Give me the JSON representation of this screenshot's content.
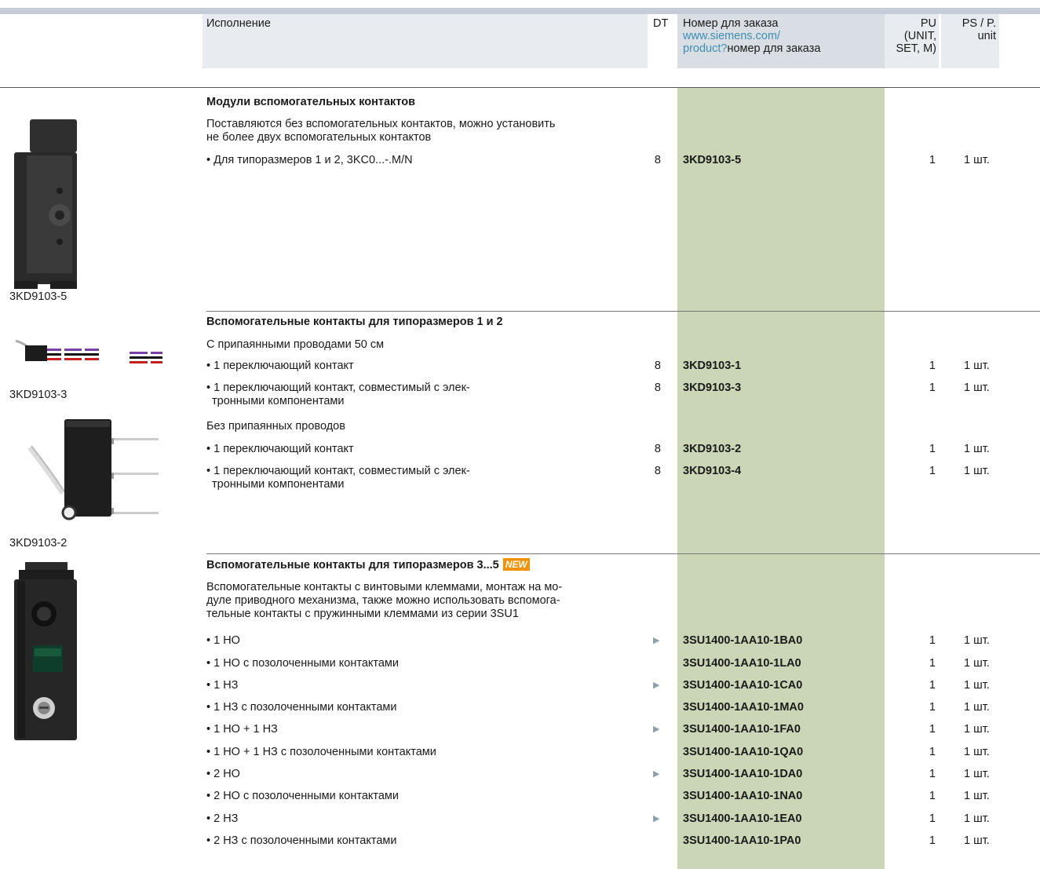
{
  "header": {
    "execution": "Исполнение",
    "dt": "DT",
    "order_line1": "Номер для заказа",
    "order_link1": "www.siemens.com/",
    "order_link2": "product?",
    "order_rest": "номер для заказа",
    "pu_line1": "PU",
    "pu_line2": "(UNIT,",
    "pu_line3": "SET, M)",
    "ps_line1": "PS / P.",
    "ps_line2": "unit"
  },
  "captions": {
    "img1": "3KD9103-5",
    "img2": "3KD9103-3",
    "img3": "3KD9103-2"
  },
  "section1": {
    "title": "Модули вспомогательных контактов",
    "desc1": "Поставляются без вспомогательных контактов, можно установить",
    "desc2": "не более двух вспомогательных контактов",
    "rows": [
      {
        "label": "• Для типоразмеров 1 и 2, 3KC0...-.M/N",
        "dt": "8",
        "order": "3KD9103-5",
        "pu": "1",
        "ps": "1 шт."
      }
    ]
  },
  "section2": {
    "title": "Вспомогательные контакты для типоразмеров 1 и 2",
    "sub1": "С припаянными проводами 50 см",
    "sub2": "Без припаянных проводов",
    "rows": [
      {
        "label": "• 1 переключающий контакт",
        "dt": "8",
        "order": "3KD9103-1",
        "pu": "1",
        "ps": "1 шт."
      },
      {
        "label": "• 1 переключающий контакт, совместимый с элек-",
        "label2": "тронными компонентами",
        "dt": "8",
        "order": "3KD9103-3",
        "pu": "1",
        "ps": "1 шт."
      },
      {
        "label": "• 1 переключающий контакт",
        "dt": "8",
        "order": "3KD9103-2",
        "pu": "1",
        "ps": "1 шт."
      },
      {
        "label": "• 1 переключающий контакт, совместимый с элек-",
        "label2": "тронными компонентами",
        "dt": "8",
        "order": "3KD9103-4",
        "pu": "1",
        "ps": "1 шт."
      }
    ]
  },
  "section3": {
    "title": "Вспомогательные контакты для типоразмеров 3...5",
    "badge": "NEW",
    "desc1": "Вспомогательные контакты с винтовыми клеммами, монтаж на мо-",
    "desc2": "дуле приводного механизма, также можно использовать вспомога-",
    "desc3": "тельные контакты с пружинными клеммами из серии 3SU1",
    "rows": [
      {
        "label": "• 1 НО",
        "order": "3SU1400-1AA10-1BA0",
        "pu": "1",
        "ps": "1 шт."
      },
      {
        "label": "• 1 НО с позолоченными контактами",
        "order": "3SU1400-1AA10-1LA0",
        "pu": "1",
        "ps": "1 шт."
      },
      {
        "label": "• 1 НЗ",
        "order": "3SU1400-1AA10-1CA0",
        "pu": "1",
        "ps": "1 шт."
      },
      {
        "label": "• 1 НЗ с позолоченными контактами",
        "order": "3SU1400-1AA10-1MA0",
        "pu": "1",
        "ps": "1 шт."
      },
      {
        "label": "• 1 НО + 1 НЗ",
        "order": "3SU1400-1AA10-1FA0",
        "pu": "1",
        "ps": "1 шт."
      },
      {
        "label": "• 1 НО + 1 НЗ с позолоченными контактами",
        "order": "3SU1400-1AA10-1QA0",
        "pu": "1",
        "ps": "1 шт."
      },
      {
        "label": "• 2 НО",
        "order": "3SU1400-1AA10-1DA0",
        "pu": "1",
        "ps": "1 шт."
      },
      {
        "label": "• 2 НО с позолоченными контактами",
        "order": "3SU1400-1AA10-1NA0",
        "pu": "1",
        "ps": "1 шт."
      },
      {
        "label": "• 2 НЗ",
        "order": "3SU1400-1AA10-1EA0",
        "pu": "1",
        "ps": "1 шт."
      },
      {
        "label": "• 2 НЗ с позолоченными контактами",
        "order": "3SU1400-1AA10-1PA0",
        "pu": "1",
        "ps": "1 шт."
      }
    ]
  },
  "icons": {
    "delivery_arrow": "arrow-right-icon"
  }
}
